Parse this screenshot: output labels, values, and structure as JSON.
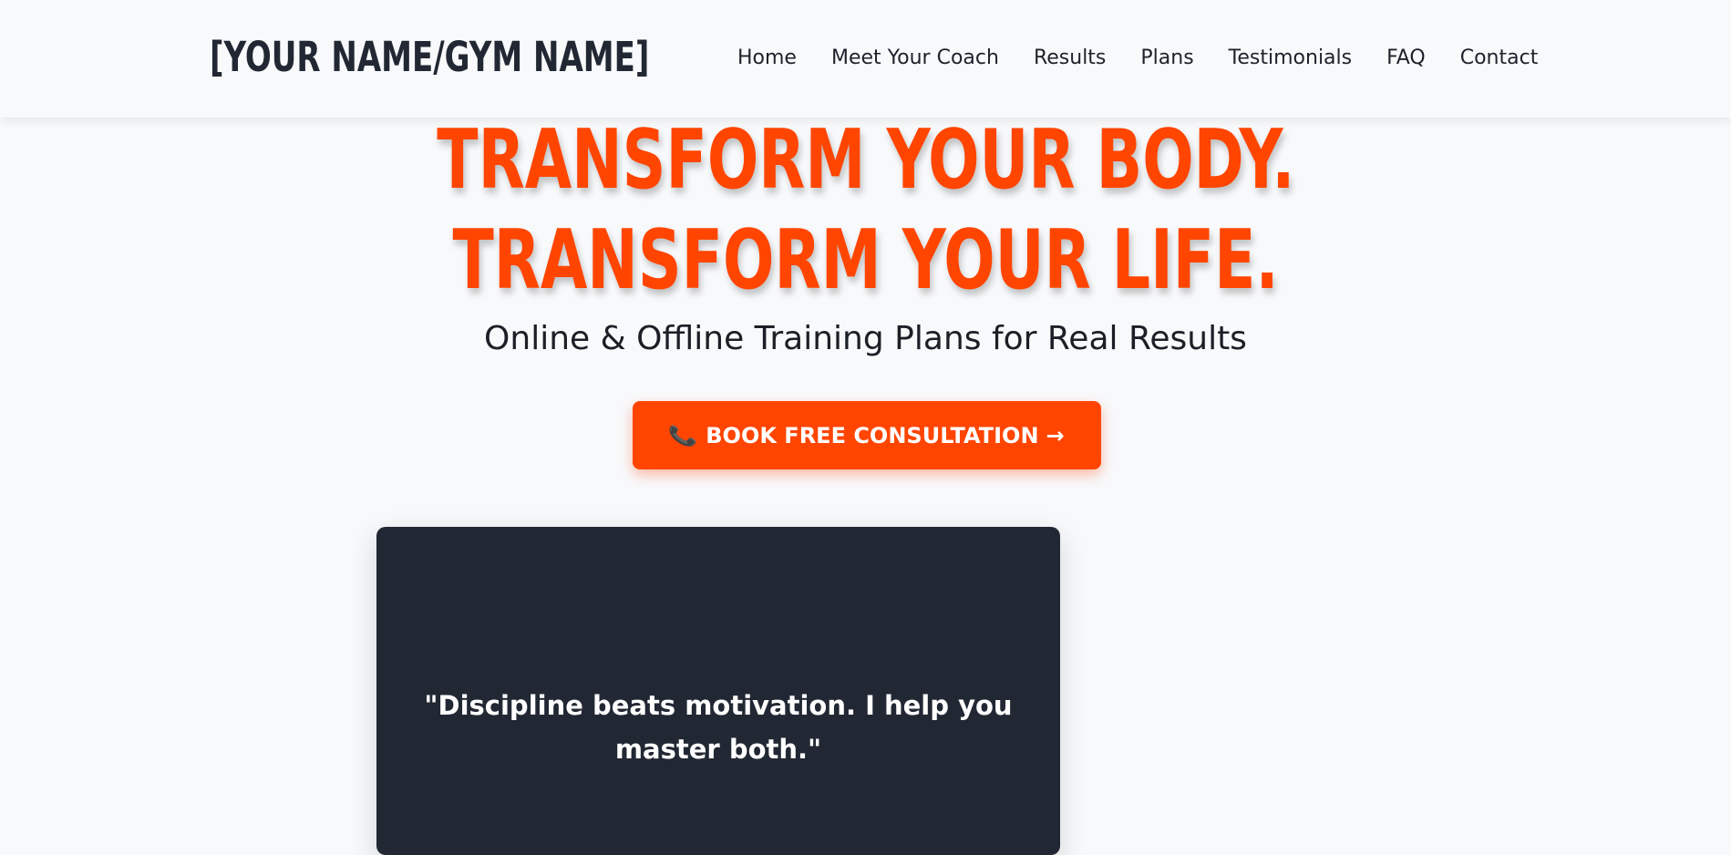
{
  "header": {
    "logo": "[YOUR NAME/GYM NAME]",
    "nav": [
      {
        "label": "Home"
      },
      {
        "label": "Meet Your Coach"
      },
      {
        "label": "Results"
      },
      {
        "label": "Plans"
      },
      {
        "label": "Testimonials"
      },
      {
        "label": "FAQ"
      },
      {
        "label": "Contact"
      }
    ]
  },
  "hero": {
    "line1": "TRANSFORM YOUR BODY.",
    "line2": "TRANSFORM YOUR LIFE.",
    "subtitle": "Online & Offline Training Plans for Real Results",
    "cta": {
      "icon": "📞",
      "label": "BOOK FREE CONSULTATION",
      "arrow": "→"
    }
  },
  "quote": {
    "text": "\"Discipline beats motivation. I help you master both.\""
  },
  "colors": {
    "accent": "#ff4500",
    "dark": "#222833",
    "background": "#f8f9fb"
  }
}
